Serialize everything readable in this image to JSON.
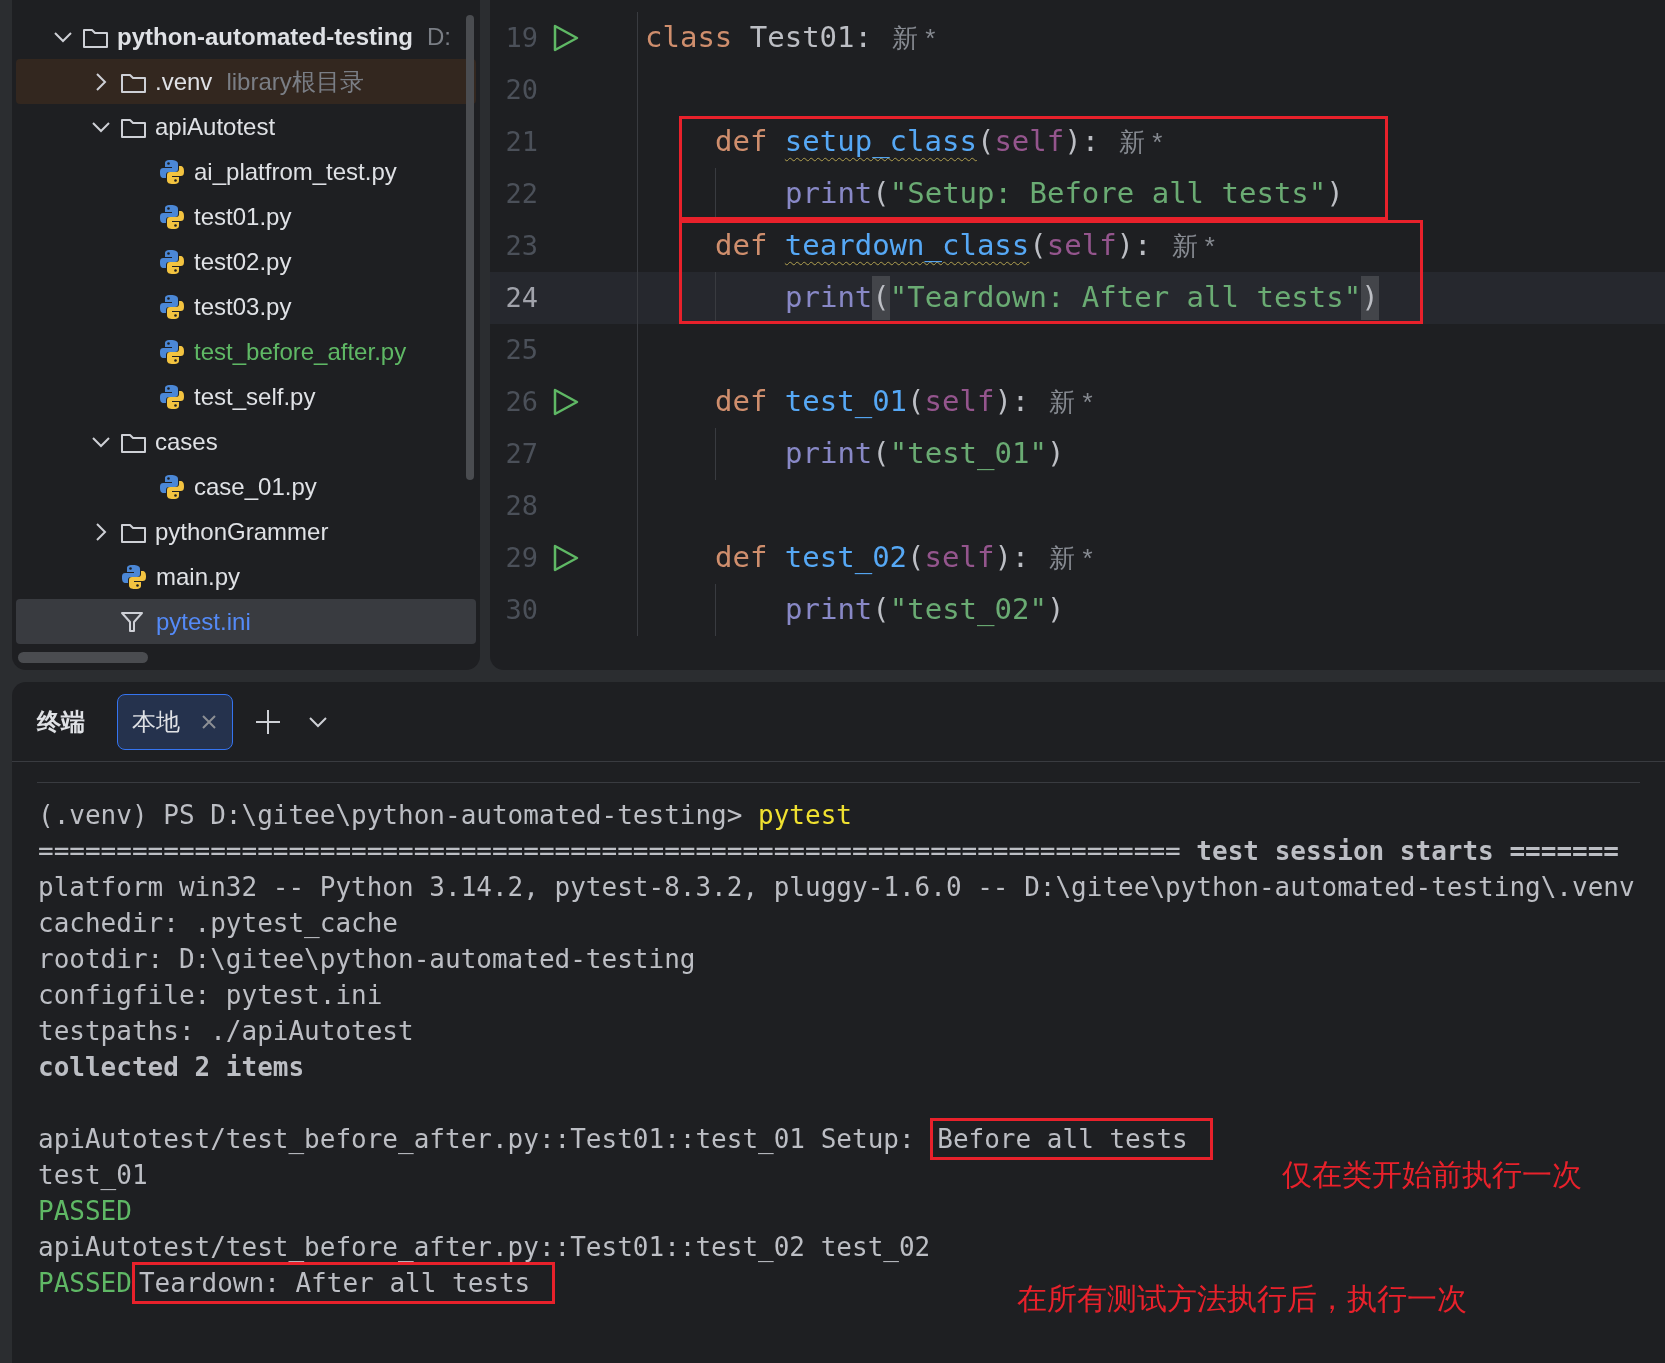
{
  "project_tree": {
    "root": {
      "name": "python-automated-testing",
      "hint": "D:",
      "expanded": true,
      "children": [
        {
          "kind": "folder",
          "name": ".venv",
          "hint": "library根目录",
          "expanded": false,
          "excluded": true,
          "color": "#dfe1e5",
          "selected": false
        },
        {
          "kind": "folder",
          "name": "apiAutotest",
          "expanded": true,
          "excluded": false,
          "color": "#dfe1e5",
          "selected": false,
          "children": [
            {
              "kind": "python",
              "name": "ai_platfrom_test.py",
              "color": "#dfe1e5",
              "selected": false
            },
            {
              "kind": "python",
              "name": "test01.py",
              "color": "#dfe1e5",
              "selected": false
            },
            {
              "kind": "python",
              "name": "test02.py",
              "color": "#dfe1e5",
              "selected": false
            },
            {
              "kind": "python",
              "name": "test03.py",
              "color": "#dfe1e5",
              "selected": false
            },
            {
              "kind": "python",
              "name": "test_before_after.py",
              "color": "#5fb865",
              "selected": false
            },
            {
              "kind": "python",
              "name": "test_self.py",
              "color": "#dfe1e5",
              "selected": false
            }
          ]
        },
        {
          "kind": "folder",
          "name": "cases",
          "expanded": true,
          "excluded": false,
          "color": "#dfe1e5",
          "selected": false,
          "children": [
            {
              "kind": "python",
              "name": "case_01.py",
              "color": "#dfe1e5",
              "selected": false
            }
          ]
        },
        {
          "kind": "folder",
          "name": "pythonGrammer",
          "expanded": false,
          "excluded": false,
          "color": "#dfe1e5",
          "selected": false
        },
        {
          "kind": "python",
          "name": "main.py",
          "excluded": false,
          "color": "#dfe1e5",
          "selected": false
        },
        {
          "kind": "ini",
          "name": "pytest.ini",
          "excluded": false,
          "color": "#548af7",
          "selected": true
        }
      ]
    }
  },
  "editor": {
    "lines": [
      {
        "number": "19",
        "run": true,
        "current": false,
        "boxed": false,
        "tokens": [
          {
            "kind": "keyword",
            "text": "class "
          },
          {
            "kind": "plain",
            "text": "Test01:"
          }
        ],
        "hint": "新 *",
        "children": [
          {
            "number": "20",
            "run": false,
            "current": false,
            "boxed": false
          },
          {
            "number": "21",
            "run": false,
            "current": false,
            "boxed": true,
            "tokens": [
              {
                "kind": "keyword",
                "text": "def "
              },
              {
                "kind": "function",
                "text": "setup_class",
                "warning": true
              },
              {
                "kind": "plain",
                "text": "("
              },
              {
                "kind": "self",
                "text": "self"
              },
              {
                "kind": "plain",
                "text": "):"
              }
            ],
            "hint": "新 *",
            "children": [
              {
                "number": "22",
                "run": false,
                "current": false,
                "boxed": false,
                "tokens": [
                  {
                    "kind": "builtin",
                    "text": "print"
                  },
                  {
                    "kind": "plain",
                    "text": "("
                  },
                  {
                    "kind": "string",
                    "text": "\"Setup: Before all tests\""
                  },
                  {
                    "kind": "plain",
                    "text": ")"
                  }
                ]
              }
            ]
          },
          {
            "number": "23",
            "run": false,
            "current": false,
            "boxed": true,
            "tokens": [
              {
                "kind": "keyword",
                "text": "def "
              },
              {
                "kind": "function",
                "text": "teardown_class",
                "warning": true
              },
              {
                "kind": "plain",
                "text": "("
              },
              {
                "kind": "self",
                "text": "self"
              },
              {
                "kind": "plain",
                "text": "):"
              }
            ],
            "hint": "新 *",
            "children": [
              {
                "number": "24",
                "run": false,
                "current": true,
                "boxed": false,
                "tokens": [
                  {
                    "kind": "builtin",
                    "text": "print"
                  },
                  {
                    "kind": "matched-brace",
                    "text": "("
                  },
                  {
                    "kind": "string",
                    "text": "\"Teardown: After all tests\""
                  },
                  {
                    "kind": "matched-brace",
                    "text": ")"
                  }
                ]
              }
            ]
          },
          {
            "number": "25",
            "run": false,
            "current": false,
            "boxed": false
          },
          {
            "number": "26",
            "run": true,
            "current": false,
            "boxed": false,
            "tokens": [
              {
                "kind": "keyword",
                "text": "def "
              },
              {
                "kind": "function",
                "text": "test_01"
              },
              {
                "kind": "plain",
                "text": "("
              },
              {
                "kind": "self",
                "text": "self"
              },
              {
                "kind": "plain",
                "text": "):"
              }
            ],
            "hint": "新 *",
            "children": [
              {
                "number": "27",
                "run": false,
                "current": false,
                "boxed": false,
                "tokens": [
                  {
                    "kind": "builtin",
                    "text": "print"
                  },
                  {
                    "kind": "plain",
                    "text": "("
                  },
                  {
                    "kind": "string",
                    "text": "\"test_01\""
                  },
                  {
                    "kind": "plain",
                    "text": ")"
                  }
                ]
              }
            ]
          },
          {
            "number": "28",
            "run": false,
            "current": false,
            "boxed": false
          },
          {
            "number": "29",
            "run": true,
            "current": false,
            "boxed": false,
            "tokens": [
              {
                "kind": "keyword",
                "text": "def "
              },
              {
                "kind": "function",
                "text": "test_02"
              },
              {
                "kind": "plain",
                "text": "("
              },
              {
                "kind": "self",
                "text": "self"
              },
              {
                "kind": "plain",
                "text": "):"
              }
            ],
            "hint": "新 *",
            "children": [
              {
                "number": "30",
                "run": false,
                "current": false,
                "boxed": false,
                "tokens": [
                  {
                    "kind": "builtin",
                    "text": "print"
                  },
                  {
                    "kind": "plain",
                    "text": "("
                  },
                  {
                    "kind": "string",
                    "text": "\"test_02\""
                  },
                  {
                    "kind": "plain",
                    "text": ")"
                  }
                ]
              }
            ]
          }
        ]
      }
    ]
  },
  "terminal": {
    "title": "终端",
    "tabs": [
      {
        "label": "本地",
        "selected": true
      }
    ],
    "blocks": [
      {
        "lines": [
          {
            "segments": [
              {
                "kind": "plain",
                "text": "(.venv) PS D:\\gitee\\python-automated-testing> "
              },
              {
                "kind": "command",
                "text": "pytest"
              }
            ]
          },
          {
            "segments": [
              {
                "kind": "plain",
                "text": "========================================================================= "
              },
              {
                "kind": "bold",
                "text": "test session starts ======="
              }
            ]
          },
          {
            "segments": [
              {
                "kind": "plain",
                "text": "platform win32 -- Python 3.14.2, pytest-8.3.2, pluggy-1.6.0 -- D:\\gitee\\python-automated-testing\\.venv"
              }
            ]
          },
          {
            "segments": [
              {
                "kind": "plain",
                "text": "cachedir: .pytest_cache"
              }
            ]
          },
          {
            "segments": [
              {
                "kind": "plain",
                "text": "rootdir: D:\\gitee\\python-automated-testing"
              }
            ]
          },
          {
            "segments": [
              {
                "kind": "plain",
                "text": "configfile: pytest.ini"
              }
            ]
          },
          {
            "segments": [
              {
                "kind": "plain",
                "text": "testpaths: ./apiAutotest"
              }
            ]
          },
          {
            "segments": [
              {
                "kind": "bold",
                "text": "collected 2 items"
              }
            ]
          }
        ]
      },
      {
        "lines": [
          {
            "segments": [
              {
                "kind": "plain",
                "text": "apiAutotest/test_before_after.py::Test01::test_01 Setup: "
              },
              {
                "kind": "boxed",
                "text": "Before all tests"
              }
            ]
          },
          {
            "segments": [
              {
                "kind": "plain",
                "text": "test_01"
              }
            ]
          },
          {
            "segments": [
              {
                "kind": "passed",
                "text": "PASSED"
              }
            ]
          },
          {
            "segments": [
              {
                "kind": "plain",
                "text": "apiAutotest/test_before_after.py::Test01::test_02 test_02"
              }
            ]
          },
          {
            "segments": [
              {
                "kind": "passed",
                "text": "PASSED"
              },
              {
                "kind": "boxed",
                "text": "Teardown: After all tests"
              }
            ]
          }
        ]
      }
    ],
    "annotations": [
      "仅在类开始前执行一次",
      "在所有测试方法执行后，执行一次"
    ]
  }
}
